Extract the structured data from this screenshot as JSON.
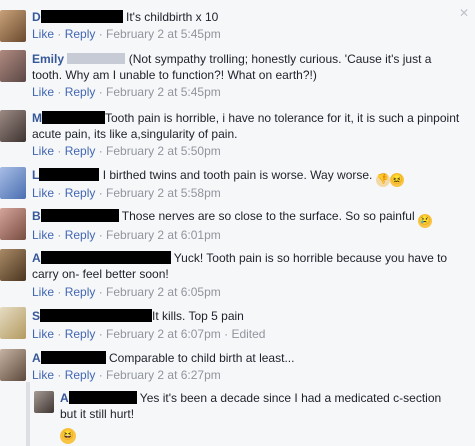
{
  "comments": [
    {
      "name": "D",
      "text": "It's childbirth x 10",
      "time": "February 2 at 5:45pm",
      "edited": ""
    },
    {
      "name": "Emily",
      "text1": "(Not sympathy trolling; honestly curious. 'Cause it's just a",
      "text2": "tooth. Why am I unable to function?! What on earth?!)",
      "time": "February 2 at 5:45pm"
    },
    {
      "name": "M",
      "text1": "Tooth pain is horrible, i have no tolerance for it, it is such a pinpoint",
      "text2": "acute pain, its like a,singularity of pain.",
      "time": "February 2 at 5:50pm"
    },
    {
      "name": "L",
      "text": "I birthed twins and tooth pain is worse. Way worse.",
      "time": "February 2 at 5:58pm"
    },
    {
      "name": "B",
      "text": "Those nerves are so close to the surface. So so painful",
      "time": "February 2 at 6:01pm"
    },
    {
      "name": "A",
      "text1": "Yuck! Tooth pain is so horrible because you have to",
      "text2": "carry on- feel better soon!",
      "time": "February 2 at 6:05pm"
    },
    {
      "name": "S",
      "text": "It kills. Top 5 pain",
      "time": "February 2 at 6:07pm",
      "edited": "Edited"
    },
    {
      "name": "A",
      "text": "Comparable to child birth at least...",
      "time": "February 2 at 6:27pm"
    }
  ],
  "reply": {
    "name": "A",
    "text1": "Yes it's been a decade since I had a medicated c-section",
    "text2": "but it still hurt!"
  },
  "actions": {
    "like": "Like",
    "reply": "Reply",
    "sep": " · "
  },
  "icons": {
    "close": "close-icon",
    "emoji": "emoji-icon"
  },
  "colors": {
    "link": "#4267b2",
    "name": "#365899",
    "meta": "#90949c",
    "bg": "#f6f7f9"
  }
}
